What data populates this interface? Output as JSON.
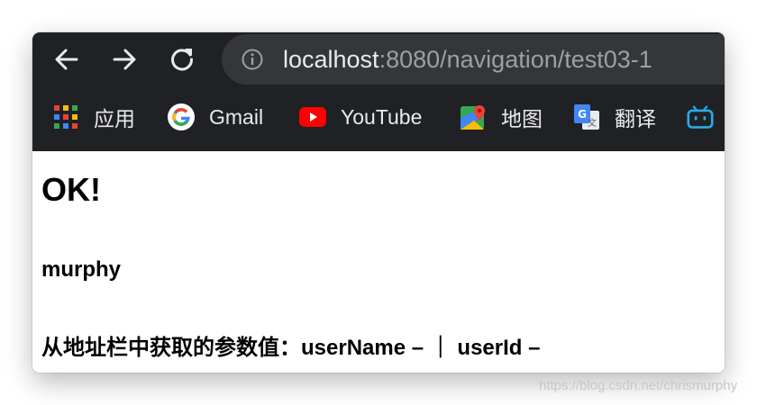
{
  "browser": {
    "url_host": "localhost",
    "url_rest": ":8080/navigation/test03-1",
    "bookmarks": [
      {
        "label": "应用",
        "icon": "apps-grid-icon"
      },
      {
        "label": "Gmail",
        "icon": "google-icon"
      },
      {
        "label": "YouTube",
        "icon": "youtube-icon"
      },
      {
        "label": "地图",
        "icon": "maps-icon"
      },
      {
        "label": "翻译",
        "icon": "translate-icon"
      },
      {
        "label": "",
        "icon": "bilibili-icon"
      }
    ],
    "colors": {
      "toolbar": "#202124",
      "omnibox": "#35363a",
      "text": "#e8eaed",
      "muted": "#9aa0a6"
    }
  },
  "page": {
    "heading": "OK!",
    "name": "murphy",
    "params_line": "从地址栏中获取的参数值：userName –  ｜  userId –"
  },
  "watermark": "https://blog.csdn.net/chrismurphy"
}
